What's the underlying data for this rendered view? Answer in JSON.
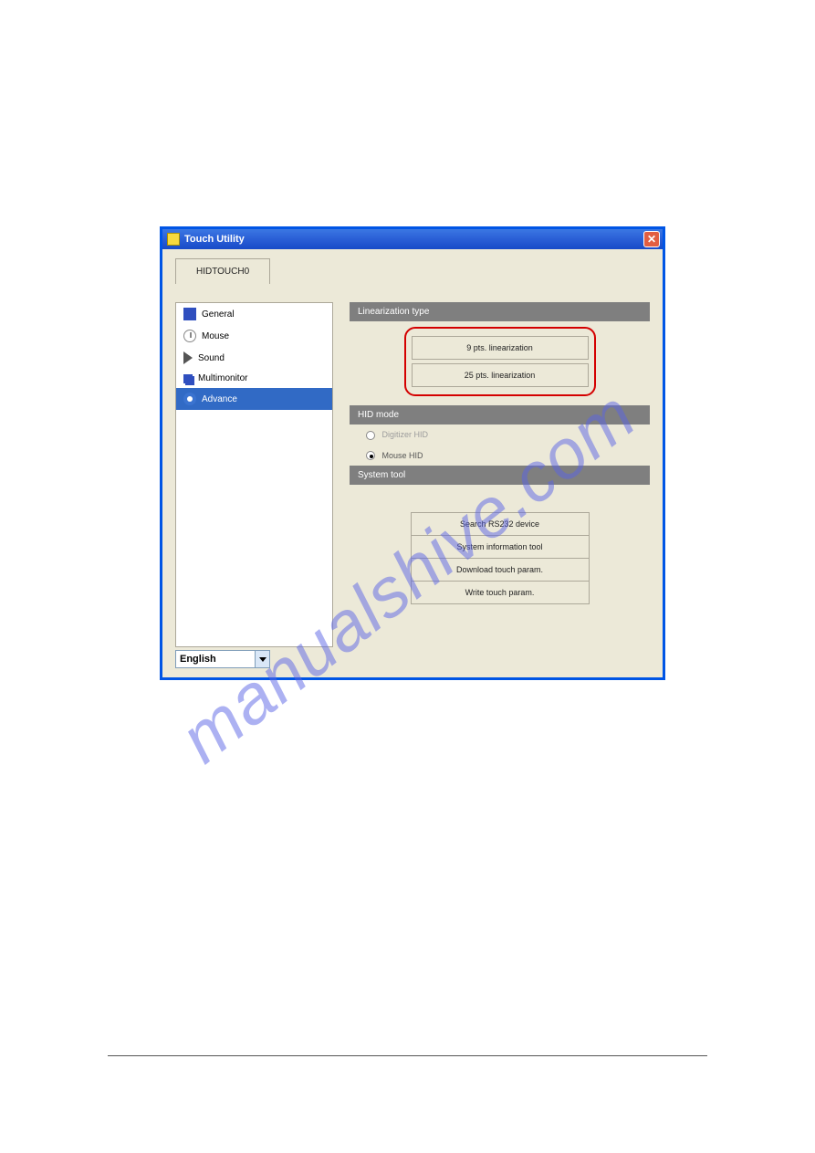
{
  "window": {
    "title": "Touch Utility"
  },
  "tab": {
    "label": "HIDTOUCH0"
  },
  "sidebar": {
    "items": [
      {
        "label": "General"
      },
      {
        "label": "Mouse"
      },
      {
        "label": "Sound"
      },
      {
        "label": "Multimonitor"
      },
      {
        "label": "Advance"
      }
    ]
  },
  "sections": {
    "linearization_header": "Linearization type",
    "hid_header": "HID mode",
    "system_header": "System tool"
  },
  "linearization": {
    "btn9": "9 pts. linearization",
    "btn25": "25 pts. linearization"
  },
  "hid": {
    "digitizer": "Digitizer HID",
    "mouse": "Mouse HID"
  },
  "system": {
    "search": "Search RS232 device",
    "info": "System information tool",
    "download": "Download touch param.",
    "write": "Write touch param."
  },
  "language": {
    "selected": "English"
  },
  "watermark": "manualshive.com"
}
